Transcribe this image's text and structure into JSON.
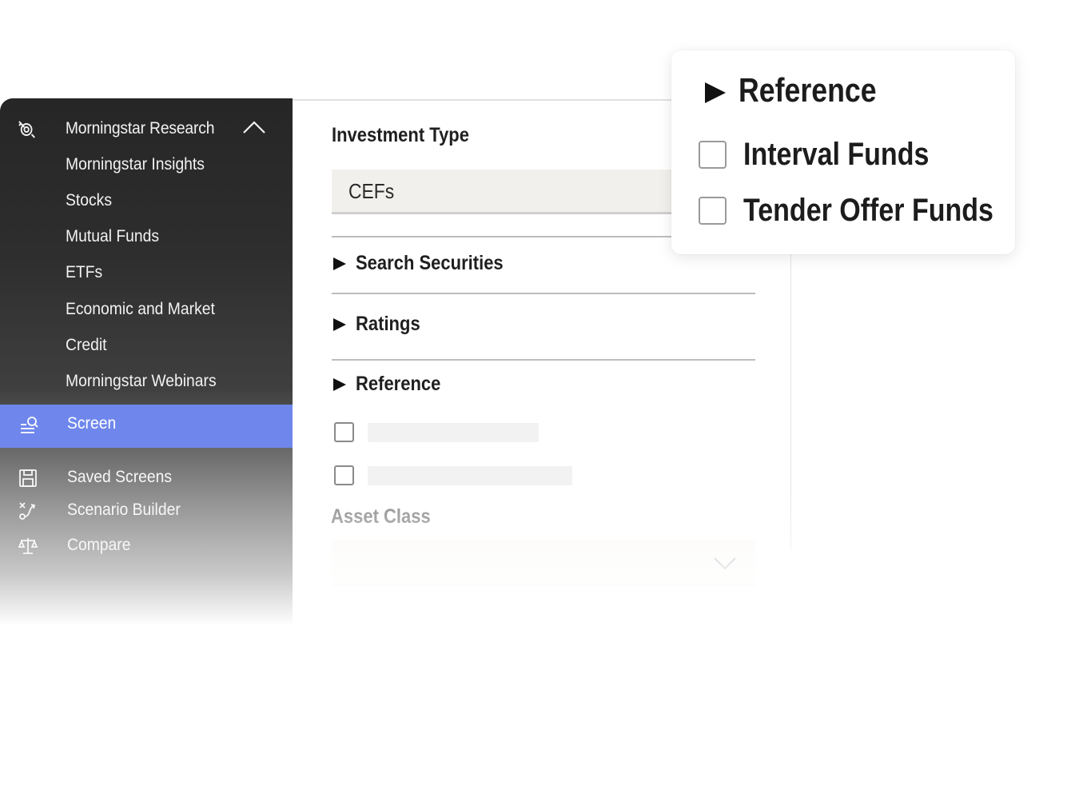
{
  "sidebar": {
    "research": {
      "label": "Morningstar Research",
      "icon": "research-target-icon",
      "expanded": true,
      "items": [
        {
          "label": "Morningstar Insights"
        },
        {
          "label": "Stocks"
        },
        {
          "label": "Mutual Funds"
        },
        {
          "label": "ETFs"
        },
        {
          "label": "Economic and Market"
        },
        {
          "label": "Credit"
        },
        {
          "label": "Morningstar Webinars"
        }
      ]
    },
    "screen": {
      "label": "Screen",
      "icon": "screen-search-icon",
      "active": true
    },
    "lower_items": [
      {
        "label": "Saved Screens",
        "icon": "save-icon"
      },
      {
        "label": "Scenario Builder",
        "icon": "scenario-icon"
      },
      {
        "label": "Compare",
        "icon": "scales-icon"
      }
    ],
    "colors": {
      "active_bg": "#6f87ec"
    }
  },
  "main": {
    "investment_type": {
      "label": "Investment Type",
      "value": "CEFs"
    },
    "accordions": [
      {
        "label": "Search Securities"
      },
      {
        "label": "Ratings"
      },
      {
        "label": "Reference",
        "expanded": true
      }
    ],
    "asset_class": {
      "label": "Asset Class"
    }
  },
  "popover": {
    "title": "Reference",
    "options": [
      {
        "label": "Interval Funds",
        "checked": false
      },
      {
        "label": "Tender Offer Funds",
        "checked": false
      }
    ]
  }
}
